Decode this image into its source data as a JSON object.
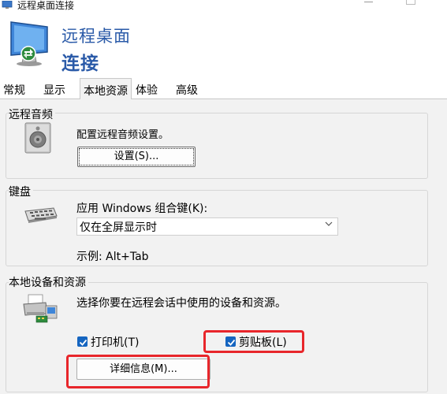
{
  "window": {
    "title": "远程桌面连接",
    "minimize_icon": "minimize-icon",
    "maximize_icon": "maximize-icon"
  },
  "header": {
    "line1": "远程桌面",
    "line2": "连接",
    "icon": "remote-desktop-icon"
  },
  "tabs": [
    {
      "label": "常规",
      "active": false
    },
    {
      "label": "显示",
      "active": false
    },
    {
      "label": "本地资源",
      "active": true
    },
    {
      "label": "体验",
      "active": false
    },
    {
      "label": "高级",
      "active": false
    }
  ],
  "audio": {
    "group_title": "远程音频",
    "description": "配置远程音频设置。",
    "button_label": "设置(S)...",
    "icon": "speaker-icon"
  },
  "keyboard": {
    "group_title": "键盘",
    "description": "应用 Windows 组合键(K):",
    "selected_option": "仅在全屏显示时",
    "example": "示例: Alt+Tab",
    "icon": "keyboard-icon"
  },
  "devices": {
    "group_title": "本地设备和资源",
    "description": "选择你要在远程会话中使用的设备和资源。",
    "printer_label": "打印机(T)",
    "printer_checked": true,
    "clipboard_label": "剪贴板(L)",
    "clipboard_checked": true,
    "details_button_label": "详细信息(M)...",
    "icon": "printer-devices-icon"
  },
  "colors": {
    "accent_blue": "#2a5aa8",
    "checkbox_blue": "#1565c0",
    "highlight_red": "#e8262b",
    "panel_bg": "#f2f2f2"
  }
}
